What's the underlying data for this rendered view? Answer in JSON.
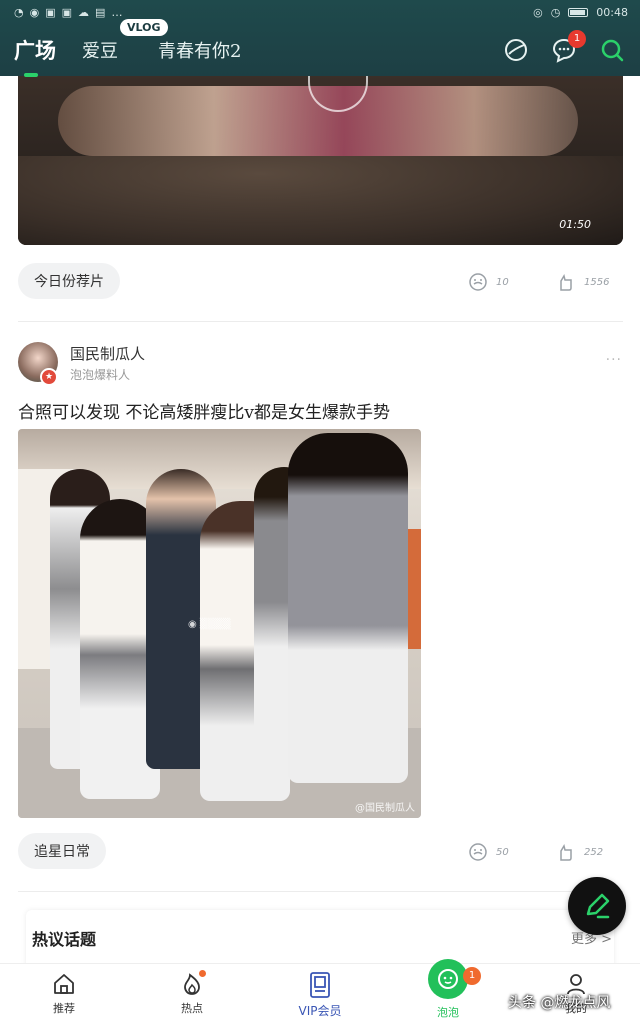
{
  "status_bar": {
    "left_icons": [
      "wifi-icon",
      "qq-icon",
      "app-icon",
      "cloud-icon",
      "news-icon",
      "more-icon"
    ],
    "time": "00:48"
  },
  "top_tabs": [
    {
      "label": "广场",
      "active": true
    },
    {
      "label": "爱豆",
      "active": false
    },
    {
      "label": "青春有你2",
      "active": false
    }
  ],
  "vlog_badge": "VLOG",
  "header": {
    "notification_count": "1"
  },
  "video_post": {
    "duration": "01:50",
    "tag": "今日份荐片",
    "comments": "10",
    "likes": "1556"
  },
  "post": {
    "author": "国民制瓜人",
    "author_subtitle": "泡泡爆料人",
    "text": "合照可以发现 不论高矮胖瘦比v都是女生爆款手势",
    "image_watermark": "@国民制瓜人",
    "tag": "追星日常",
    "comments": "50",
    "likes": "252"
  },
  "topics": {
    "title": "热议话题",
    "more": "更多 >"
  },
  "bottom_nav": [
    {
      "label": "推荐"
    },
    {
      "label": "热点"
    },
    {
      "label": "VIP会员"
    },
    {
      "label": "泡泡",
      "badge": "1"
    },
    {
      "label": "我的"
    }
  ],
  "credit": "头条 @燃龙点风",
  "colors": {
    "header_bg": "#1f4a4c",
    "accent_green": "#22c05a",
    "badge_red": "#e8392e"
  }
}
